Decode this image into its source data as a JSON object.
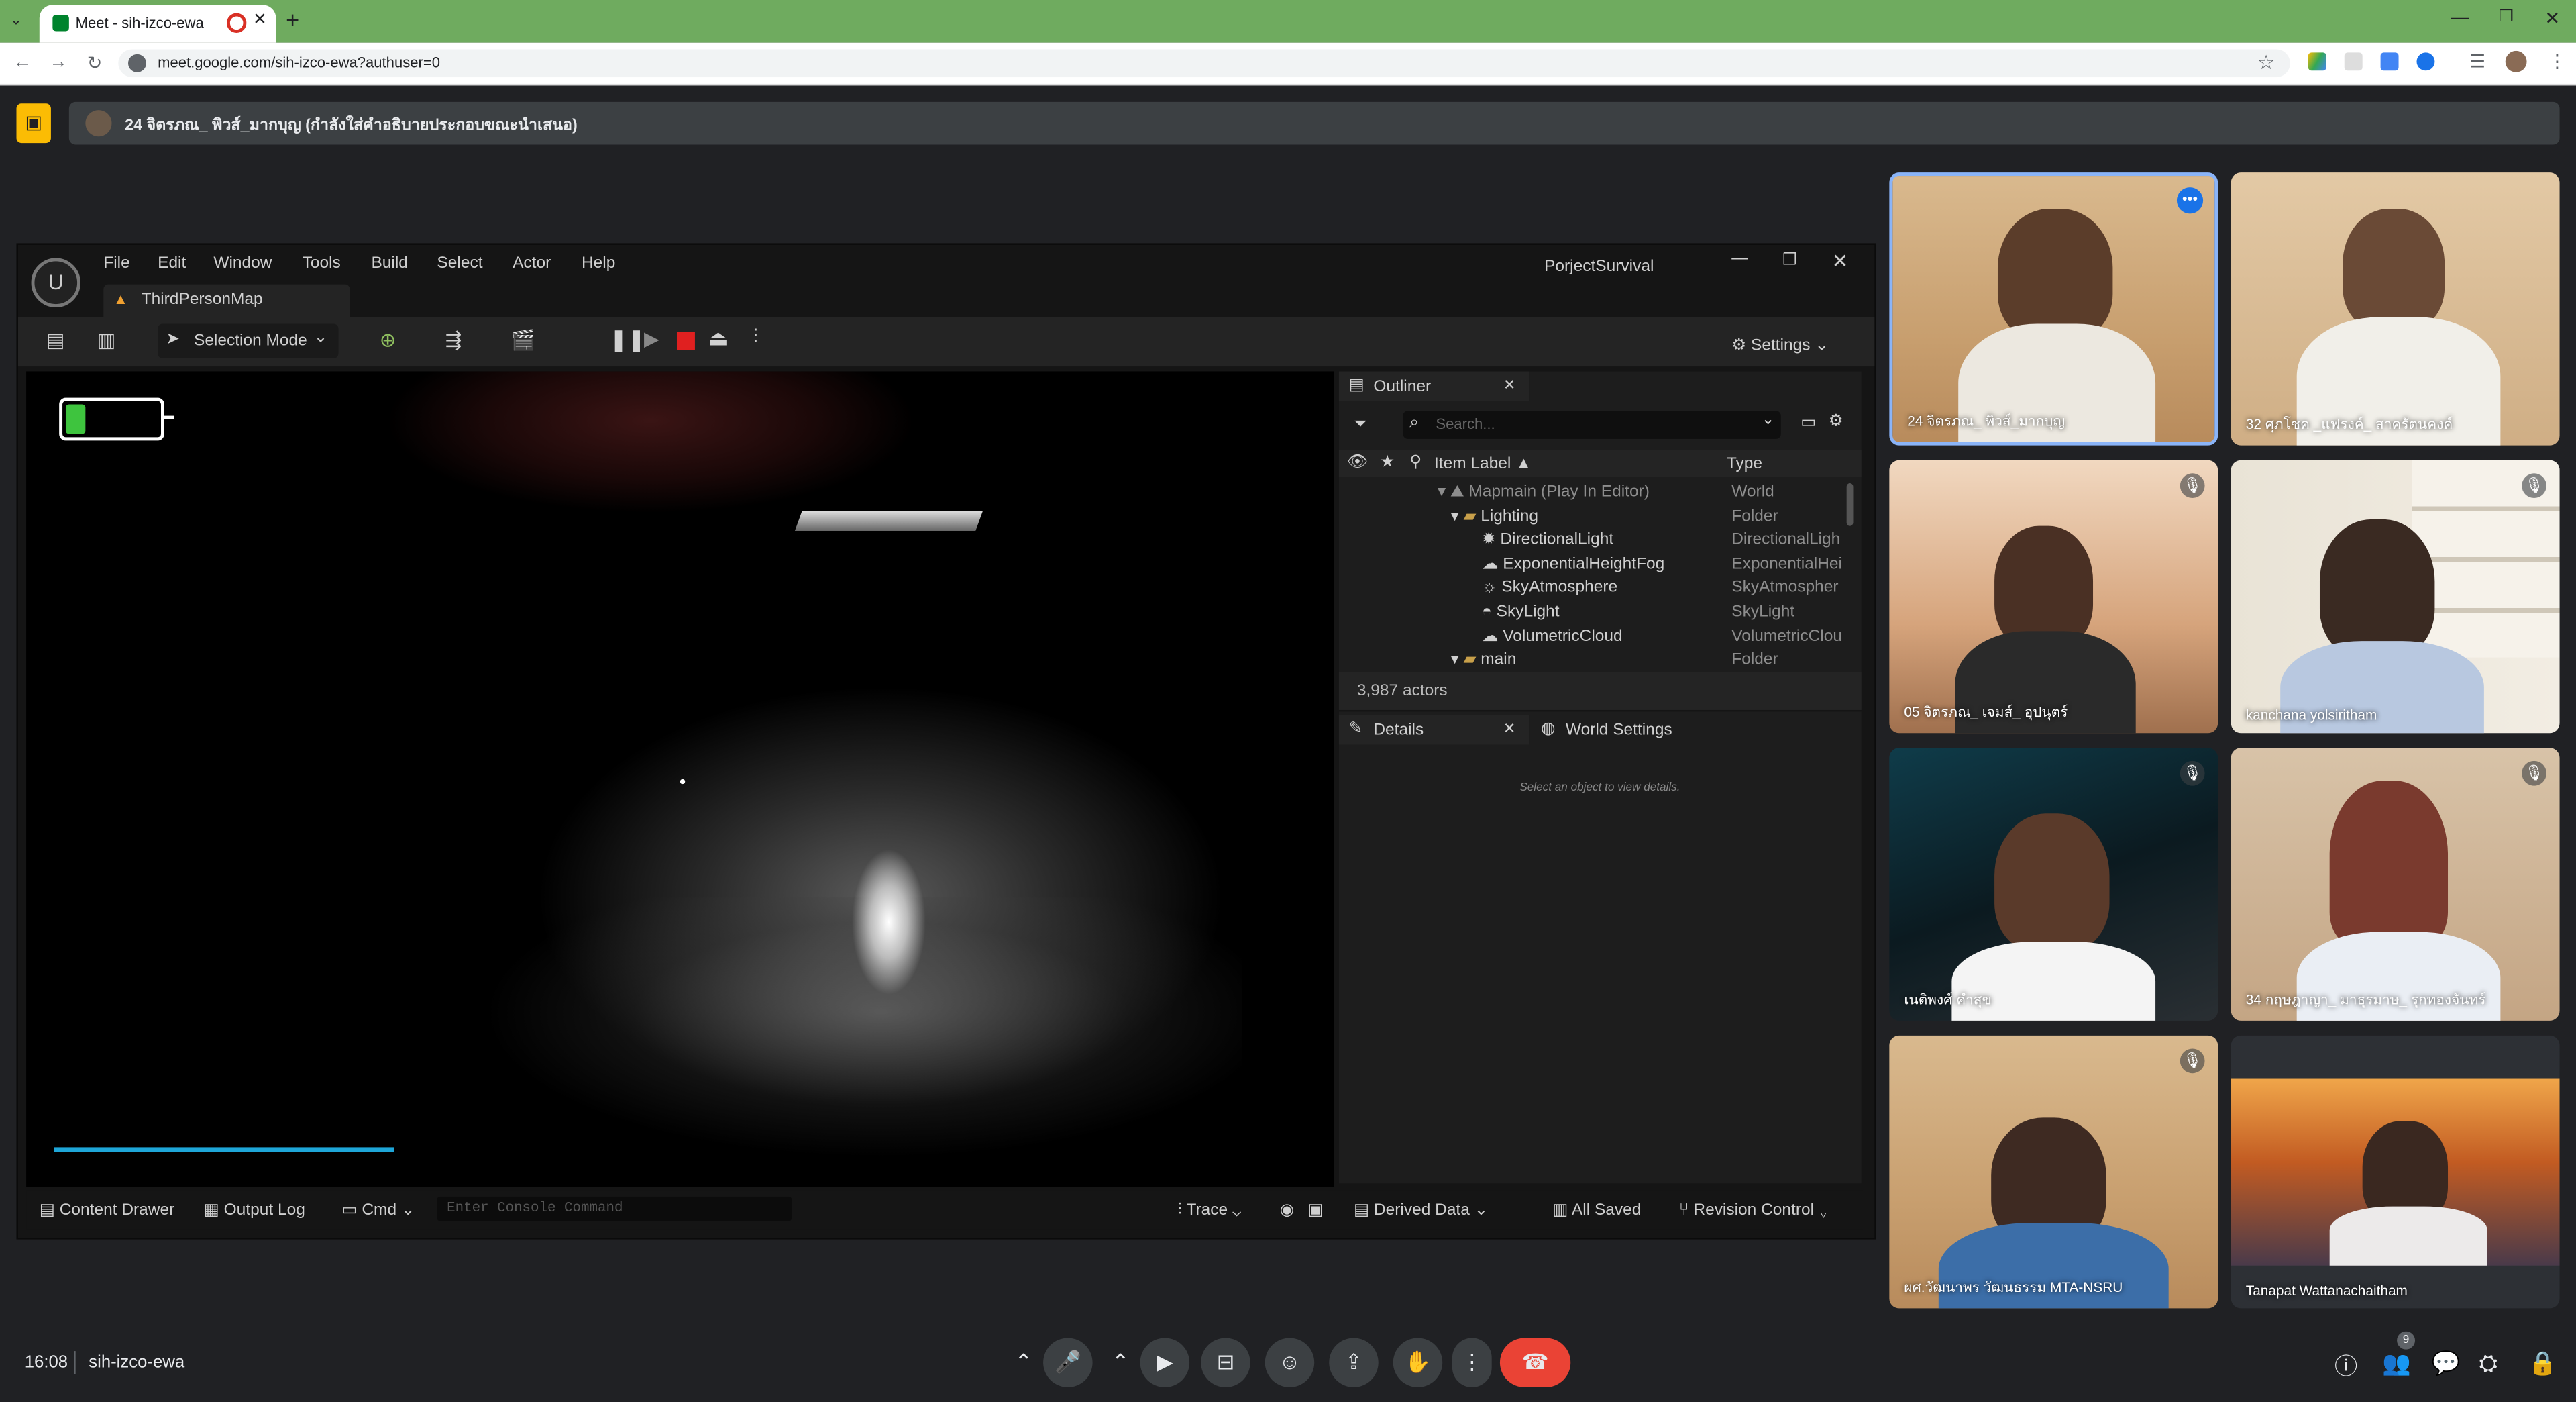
{
  "browser": {
    "tab_title": "Meet - sih-izco-ewa",
    "url": "meet.google.com/sih-izco-ewa?authuser=0",
    "theme_color": "#6fab5f"
  },
  "meet": {
    "presenter_banner": "24 จิตรภณ_ พิวส์_มากบุญ (กำลังใส่คำอธิบายประกอบขณะนำเสนอ)",
    "time": "16:08",
    "meeting_code": "sih-izco-ewa",
    "people_count": "9",
    "end_call_color": "#ea4335",
    "present_icon_color": "#fbbc04"
  },
  "ue": {
    "menu": [
      "File",
      "Edit",
      "Window",
      "Tools",
      "Build",
      "Select",
      "Actor",
      "Help"
    ],
    "project_name": "PorjectSurvival",
    "map_tab": "ThirdPersonMap",
    "selection_mode": "Selection Mode",
    "settings": "Settings",
    "outliner": {
      "tab": "Outliner",
      "search_placeholder": "Search...",
      "col_label": "Item Label ▲",
      "col_type": "Type",
      "rows": [
        {
          "label": "Mapmain (Play In Editor)",
          "type": "World"
        },
        {
          "label": "Lighting",
          "type": "Folder"
        },
        {
          "label": "DirectionalLight",
          "type": "DirectionalLigh"
        },
        {
          "label": "ExponentialHeightFog",
          "type": "ExponentialHei"
        },
        {
          "label": "SkyAtmosphere",
          "type": "SkyAtmospher"
        },
        {
          "label": "SkyLight",
          "type": "SkyLight"
        },
        {
          "label": "VolumetricCloud",
          "type": "VolumetricClou"
        },
        {
          "label": "main",
          "type": "Folder"
        }
      ],
      "actor_count": "3,987 actors"
    },
    "details": {
      "tab": "Details",
      "world_settings_tab": "World Settings",
      "empty_message": "Select an object to view details."
    },
    "statusbar": {
      "content_drawer": "Content Drawer",
      "output_log": "Output Log",
      "cmd": "Cmd",
      "console_placeholder": "Enter Console Command",
      "trace": "Trace",
      "derived_data": "Derived Data",
      "all_saved": "All Saved",
      "revision_control": "Revision Control"
    },
    "battery_level": 0.2,
    "progress_level": 0.26
  },
  "participants": [
    {
      "name": "24 จิตรภณ_ พิวส์_มากบุญ",
      "active_speaker": true,
      "muted": false
    },
    {
      "name": "32 ศุภโชค _แฟรงค์_ สาครัตนคงค์",
      "muted": false
    },
    {
      "name": "05 จิตรภณ_ เจมส์_ อุปนุตร์",
      "muted": true
    },
    {
      "name": "kanchana yolsiritham",
      "muted": true
    },
    {
      "name": "เนติพงศ์ คำสุข",
      "muted": true
    },
    {
      "name": "34 กฤษฎาญา_ มาธุรมาษ_ รุกทองจันทร์",
      "muted": true
    },
    {
      "name": "ผศ.วัฒนาพร วัฒนธรรม MTA-NSRU",
      "muted": true
    },
    {
      "name": "Tanapat Wattanachaitham",
      "muted": false
    }
  ]
}
